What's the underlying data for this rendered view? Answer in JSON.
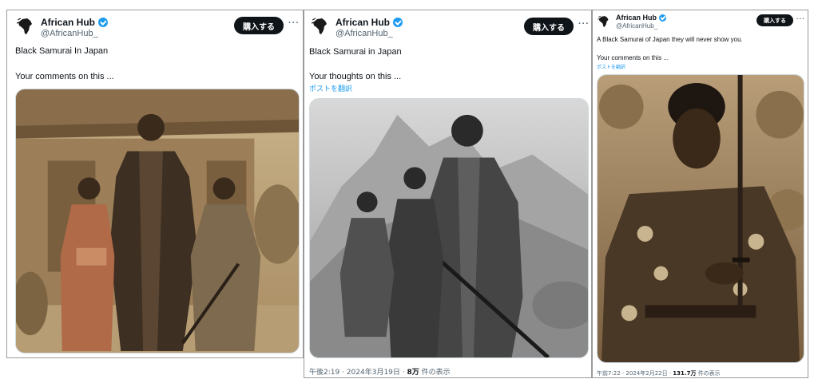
{
  "posts": [
    {
      "author": {
        "name": "African Hub",
        "handle": "@AfricanHub_"
      },
      "buy_label": "購入する",
      "more_label": "···",
      "line1": "Black Samurai In Japan",
      "line2": "Your comments on this ...",
      "image_alt": "Sepia photograph of a samurai man with two children in kimonos"
    },
    {
      "author": {
        "name": "African Hub",
        "handle": "@AfricanHub_"
      },
      "buy_label": "購入する",
      "more_label": "···",
      "line1": "Black Samurai in Japan",
      "line2": "Your thoughts on this ...",
      "translate_label": "ポストを翻訳",
      "image_alt": "Black and white photograph of a samurai with a woman and child in mountains",
      "meta": {
        "time": "午後2:19",
        "date": "2024年3月19日",
        "views_count": "8万",
        "views_label": "件の表示"
      }
    },
    {
      "author": {
        "name": "African Hub",
        "handle": "@AfricanHub_"
      },
      "buy_label": "購入する",
      "more_label": "···",
      "line1": "A Black Samurai of Japan they will never show you.",
      "line2": "Your comments on this ...",
      "translate_label": "ポストを翻訳",
      "image_alt": "Sepia photograph of a samurai in floral kimono holding a sword",
      "meta": {
        "time": "午前7:22",
        "date": "2024年2月22日",
        "views_count": "131.7万",
        "views_label": "件の表示"
      }
    }
  ],
  "colors": {
    "accent": "#1d9bf0",
    "button": "#0f1419",
    "secondary": "#536471"
  },
  "icons": {
    "verified": "verified-badge-icon",
    "avatar": "africa-logo-avatar",
    "more": "more-icon"
  }
}
